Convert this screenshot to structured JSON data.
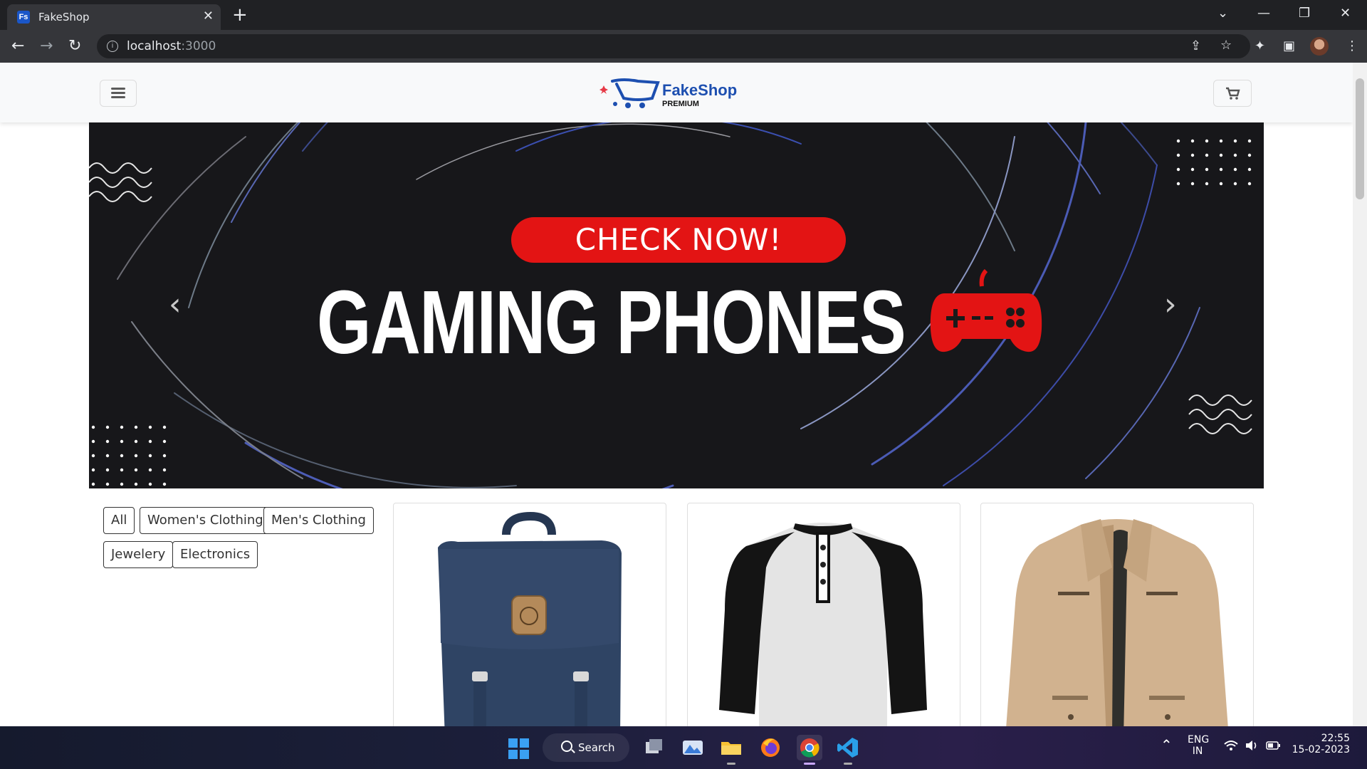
{
  "browser": {
    "tab": {
      "favicon_text": "Fs",
      "title": "FakeShop",
      "close": "✕"
    },
    "new_tab": "+",
    "window_controls": {
      "tablist": "⌄",
      "minimize": "—",
      "restore": "❐",
      "close": "✕"
    },
    "nav": {
      "back": "←",
      "forward": "→",
      "reload": "↻"
    },
    "address": {
      "host": "localhost",
      "port": ":3000"
    }
  },
  "site": {
    "logo": {
      "name": "FakeShop",
      "tagline": "PREMIUM"
    },
    "banner": {
      "cta": "CHECK NOW!",
      "headline": "GAMING PHONES",
      "prev": "‹",
      "next": "›"
    },
    "filters": [
      {
        "label": "All"
      },
      {
        "label": "Women's Clothing"
      },
      {
        "label": "Men's Clothing"
      },
      {
        "label": "Jewelery"
      },
      {
        "label": "Electronics"
      }
    ],
    "products": [
      {
        "name": "backpack"
      },
      {
        "name": "raglan-henley-shirt"
      },
      {
        "name": "khaki-jacket"
      }
    ]
  },
  "taskbar": {
    "search_label": "Search",
    "language": {
      "line1": "ENG",
      "line2": "IN"
    },
    "clock": {
      "time": "22:55",
      "date": "15-02-2023"
    }
  },
  "colors": {
    "accent_red": "#e31414",
    "logo_blue": "#1d4fb0",
    "banner_bg": "#17171a"
  }
}
